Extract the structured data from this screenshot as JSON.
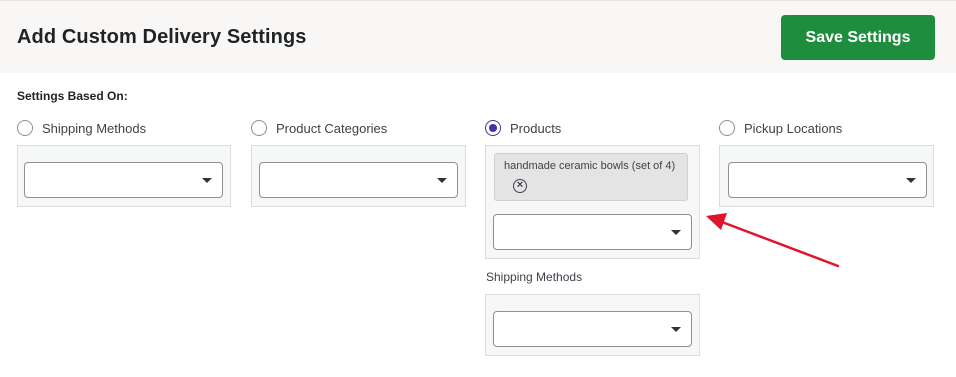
{
  "header": {
    "title": "Add Custom Delivery Settings",
    "save_label": "Save Settings"
  },
  "settings": {
    "label": "Settings Based On:",
    "options": [
      {
        "label": "Shipping Methods",
        "checked": false
      },
      {
        "label": "Product Categories",
        "checked": false
      },
      {
        "label": "Products",
        "checked": true
      },
      {
        "label": "Pickup Locations",
        "checked": false
      }
    ]
  },
  "products": {
    "selected_tag": "handmade ceramic bowls (set of 4)",
    "remove_glyph": "×"
  },
  "sub_section": {
    "label": "Shipping Methods"
  },
  "colors": {
    "primary_button": "#1e8e3e",
    "radio_checked": "#4b2fa8",
    "annotation_arrow": "#e0142c"
  },
  "icons": [
    "chevron-down-icon",
    "remove-circle-icon",
    "annotation-arrow"
  ]
}
